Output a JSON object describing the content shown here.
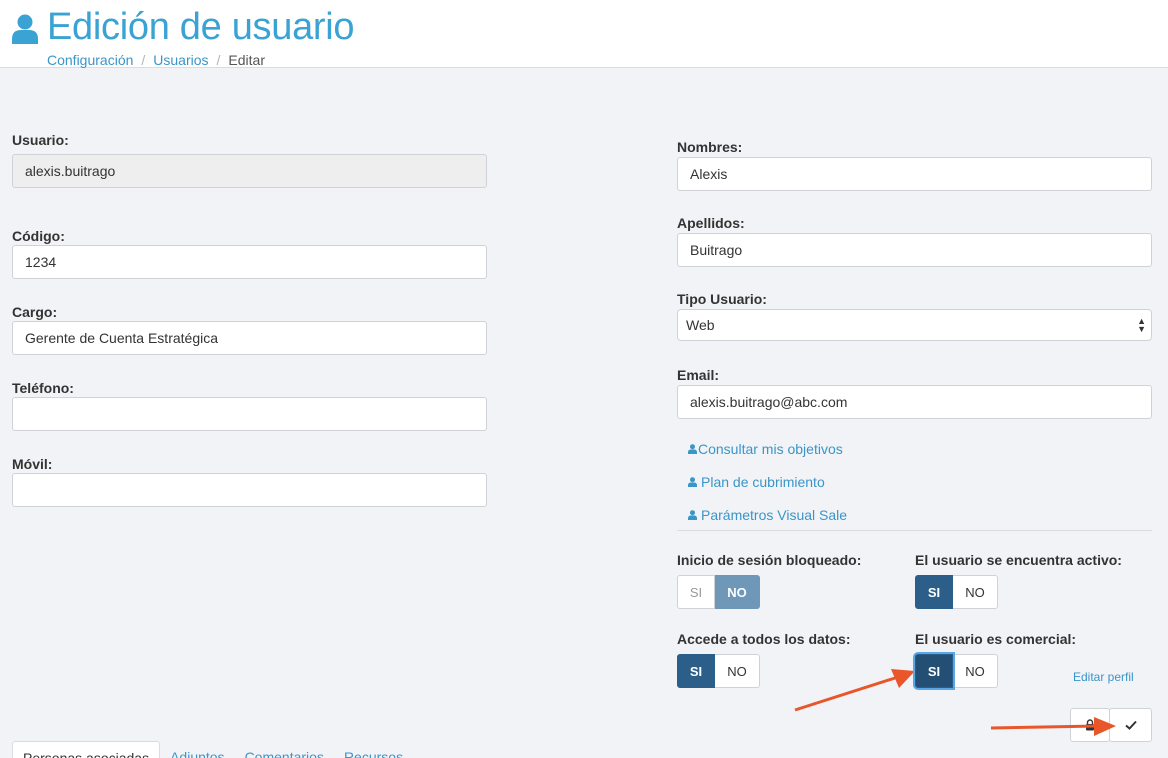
{
  "header": {
    "title": "Edición de usuario",
    "breadcrumb": {
      "items": [
        "Configuración",
        "Usuarios"
      ],
      "separator": "/",
      "current": "Editar"
    }
  },
  "left_form": {
    "usuario": {
      "label": "Usuario:",
      "value": "alexis.buitrago"
    },
    "codigo": {
      "label": "Código:",
      "value": "1234"
    },
    "cargo": {
      "label": "Cargo:",
      "value": "Gerente de Cuenta Estratégica"
    },
    "telefono": {
      "label": "Teléfono:",
      "value": ""
    },
    "movil": {
      "label": "Móvil:",
      "value": ""
    }
  },
  "right_form": {
    "nombres": {
      "label": "Nombres:",
      "value": "Alexis"
    },
    "apellidos": {
      "label": "Apellidos:",
      "value": "Buitrago"
    },
    "tipo_usuario": {
      "label": "Tipo Usuario:",
      "selected": "Web"
    },
    "email": {
      "label": "Email:",
      "value": "alexis.buitrago@abc.com"
    }
  },
  "links": [
    {
      "label": "Consultar mis objetivos",
      "icon": "user-icon"
    },
    {
      "label": "Plan de cubrimiento",
      "icon": "user-icon"
    },
    {
      "label": "Parámetros Visual Sale",
      "icon": "user-icon"
    }
  ],
  "toggles": {
    "bloqueado": {
      "label": "Inicio de sesión bloqueado:",
      "yes": "SI",
      "no": "NO",
      "selected": "NO"
    },
    "activo": {
      "label": "El usuario se encuentra activo:",
      "yes": "SI",
      "no": "NO",
      "selected": "SI"
    },
    "todos_datos": {
      "label": "Accede a todos los datos:",
      "yes": "SI",
      "no": "NO",
      "selected": "SI"
    },
    "comercial": {
      "label": "El usuario es comercial:",
      "yes": "SI",
      "no": "NO",
      "selected": "SI"
    }
  },
  "editar_perfil": "Editar perfil",
  "actions": {
    "lock_icon": "lock-icon",
    "save_icon": "check-icon"
  },
  "tabs": [
    "Personas asociadas",
    "Adjuntos",
    "Comentarios",
    "Recursos"
  ],
  "colors": {
    "accent": "#3aa3d3",
    "toggle_on": "#2b5f8a",
    "annotation_arrow": "#e8562a"
  }
}
